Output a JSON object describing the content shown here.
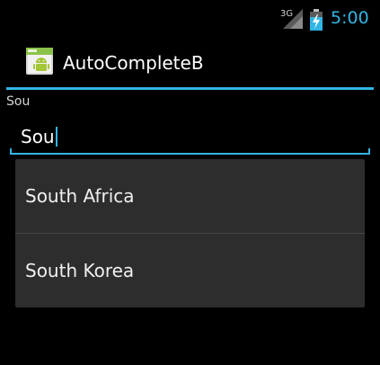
{
  "status_bar": {
    "network_type": "3G",
    "time": "5:00"
  },
  "action_bar": {
    "title": "AutoCompleteB",
    "icon": "android-app-icon"
  },
  "echo_label": "Sou",
  "autocomplete": {
    "value": "Sou",
    "suggestions": [
      "South Africa",
      "South Korea"
    ]
  },
  "colors": {
    "accent": "#33b5e5",
    "background": "#000000",
    "dropdown_bg": "#2d2d2d"
  }
}
